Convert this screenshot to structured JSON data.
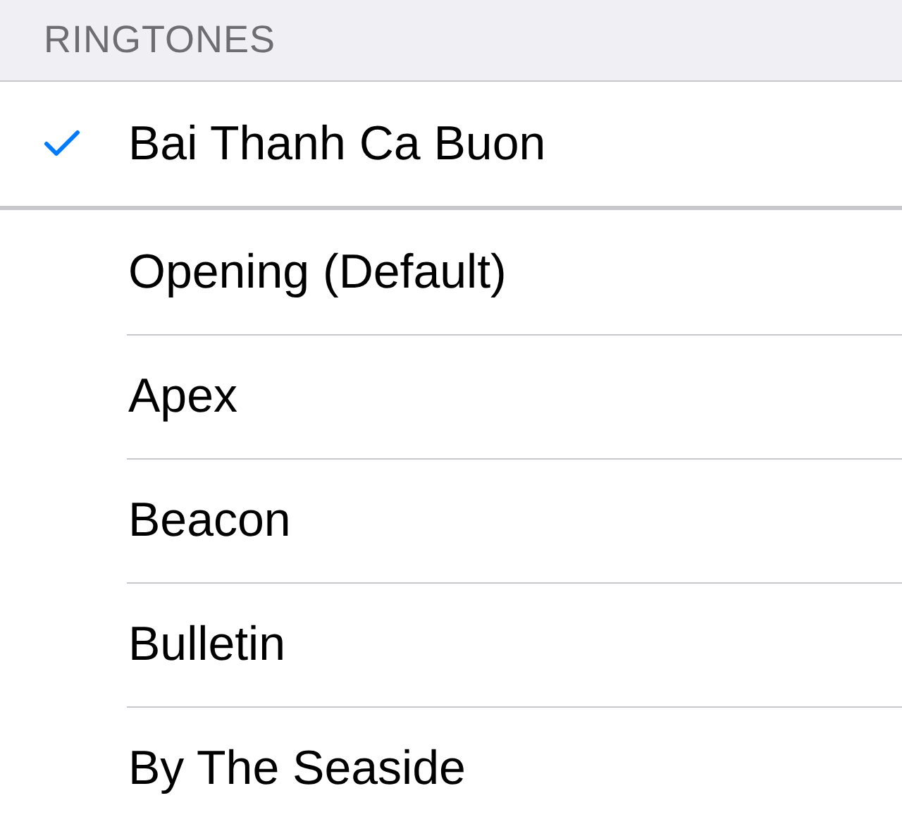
{
  "header": "RINGTONES",
  "groups": [
    {
      "items": [
        {
          "label": "Bai Thanh Ca Buon",
          "selected": true
        }
      ]
    },
    {
      "items": [
        {
          "label": "Opening (Default)",
          "selected": false
        },
        {
          "label": "Apex",
          "selected": false
        },
        {
          "label": "Beacon",
          "selected": false
        },
        {
          "label": "Bulletin",
          "selected": false
        },
        {
          "label": "By The Seaside",
          "selected": false
        }
      ]
    }
  ]
}
